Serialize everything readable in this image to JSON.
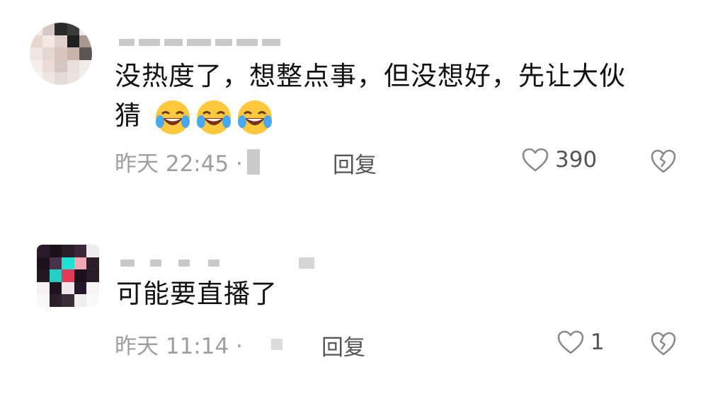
{
  "comments": [
    {
      "text": "没热度了，想整点事，但没想好，先让大伙猜",
      "text_line1": "没热度了，想整点事，但没想好，先让大伙",
      "text_line2": "猜",
      "emojis": [
        "laughing-crying-emoji",
        "laughing-crying-emoji",
        "laughing-crying-emoji"
      ],
      "time": "昨天 22:45 · ",
      "reply_label": "回复",
      "like_count": "390",
      "like_icon": "heart-outline-icon",
      "dislike_icon": "broken-heart-icon"
    },
    {
      "text": "可能要直播了",
      "time": "昨天 11:14 · ",
      "reply_label": "回复",
      "like_count": "1",
      "like_icon": "heart-outline-icon",
      "dislike_icon": "broken-heart-icon"
    }
  ],
  "colors": {
    "text": "#111111",
    "meta": "#9e9e9e",
    "action": "#555555",
    "background": "#ffffff"
  }
}
